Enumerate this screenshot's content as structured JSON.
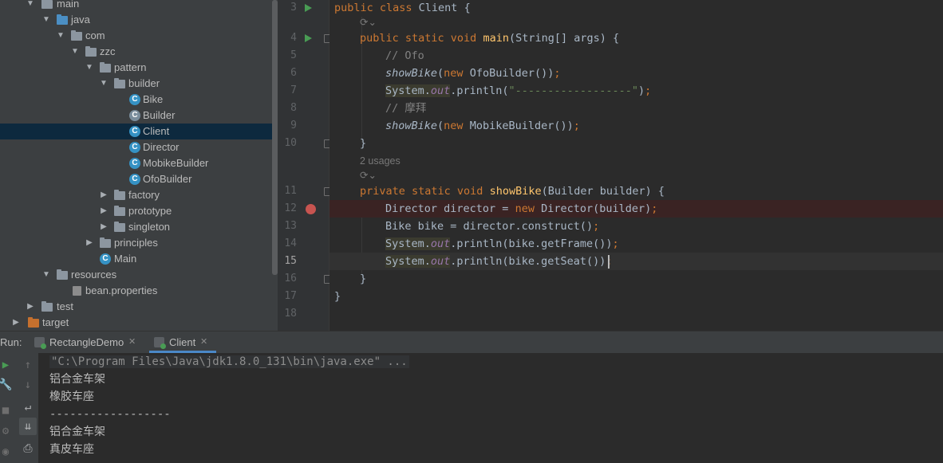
{
  "project_tree": {
    "items": [
      {
        "label": "main",
        "type": "folder",
        "expanded": true
      },
      {
        "label": "java",
        "type": "source-folder",
        "expanded": true
      },
      {
        "label": "com",
        "type": "package",
        "expanded": true
      },
      {
        "label": "zzc",
        "type": "package",
        "expanded": true
      },
      {
        "label": "pattern",
        "type": "package",
        "expanded": true
      },
      {
        "label": "builder",
        "type": "package",
        "expanded": true
      },
      {
        "label": "Bike",
        "type": "class"
      },
      {
        "label": "Builder",
        "type": "abstract-class"
      },
      {
        "label": "Client",
        "type": "class-runnable",
        "selected": true
      },
      {
        "label": "Director",
        "type": "class"
      },
      {
        "label": "MobikeBuilder",
        "type": "class"
      },
      {
        "label": "OfoBuilder",
        "type": "class"
      },
      {
        "label": "factory",
        "type": "package",
        "expanded": false
      },
      {
        "label": "prototype",
        "type": "package",
        "expanded": false
      },
      {
        "label": "singleton",
        "type": "package",
        "expanded": false
      },
      {
        "label": "principles",
        "type": "package",
        "expanded": false
      },
      {
        "label": "Main",
        "type": "class-runnable"
      },
      {
        "label": "resources",
        "type": "resource-folder",
        "expanded": true
      },
      {
        "label": "bean.properties",
        "type": "properties-file"
      },
      {
        "label": "test",
        "type": "folder",
        "expanded": false
      },
      {
        "label": "target",
        "type": "excluded-folder",
        "expanded": false
      }
    ]
  },
  "editor": {
    "line_numbers": [
      "3",
      "4",
      "5",
      "6",
      "7",
      "8",
      "9",
      "10",
      "11",
      "12",
      "13",
      "14",
      "15",
      "16",
      "17",
      "18"
    ],
    "usages_hint": "2 usages",
    "code": {
      "l3_kw": "public class ",
      "l3_rest": "Client {",
      "l4_kw": "public static void ",
      "l4_fn": "main",
      "l4_rest": "(String[] args) {",
      "l5_cm": "// Ofo",
      "l6_it": "showBike",
      "l6_p1": "(",
      "l6_kw": "new ",
      "l6_rest": "OfoBuilder())",
      "l6_semi": ";",
      "l7_sys": "System.",
      "l7_out": "out",
      "l7_call": ".println(",
      "l7_str": "\"------------------\"",
      "l7_end": ")",
      "l7_semi": ";",
      "l8_cm": "// 摩拜",
      "l9_it": "showBike",
      "l9_p1": "(",
      "l9_kw": "new ",
      "l9_rest": "MobikeBuilder())",
      "l9_semi": ";",
      "l10": "}",
      "l11_kw": "private static void ",
      "l11_fn": "showBike",
      "l11_rest": "(Builder builder) {",
      "l12_a": "Director director = ",
      "l12_kw": "new ",
      "l12_b": "Director(builder)",
      "l12_semi": ";",
      "l13_a": "Bike bike = director.construct()",
      "l13_semi": ";",
      "l14_sys": "System.",
      "l14_out": "out",
      "l14_rest": ".println(bike.getFrame())",
      "l14_semi": ";",
      "l15_sys": "System.",
      "l15_out": "out",
      "l15_rest": ".println(bike.getSeat())",
      "l15_semi": ";",
      "l16": "}",
      "l17": "}"
    }
  },
  "run_panel": {
    "label": "Run:",
    "tabs": [
      {
        "label": "RectangleDemo",
        "active": false
      },
      {
        "label": "Client",
        "active": true
      }
    ],
    "console_lines": [
      "\"C:\\Program Files\\Java\\jdk1.8.0_131\\bin\\java.exe\" ...",
      "铝合金车架",
      "橡胶车座",
      "------------------",
      "铝合金车架",
      "真皮车座"
    ]
  },
  "colors": {
    "keyword": "#cc7832",
    "method_decl": "#ffc66d",
    "comment": "#808080",
    "string": "#6a8759",
    "static_field": "#9876aa",
    "breakpoint": "#c75450",
    "run_gutter": "#499c54"
  }
}
